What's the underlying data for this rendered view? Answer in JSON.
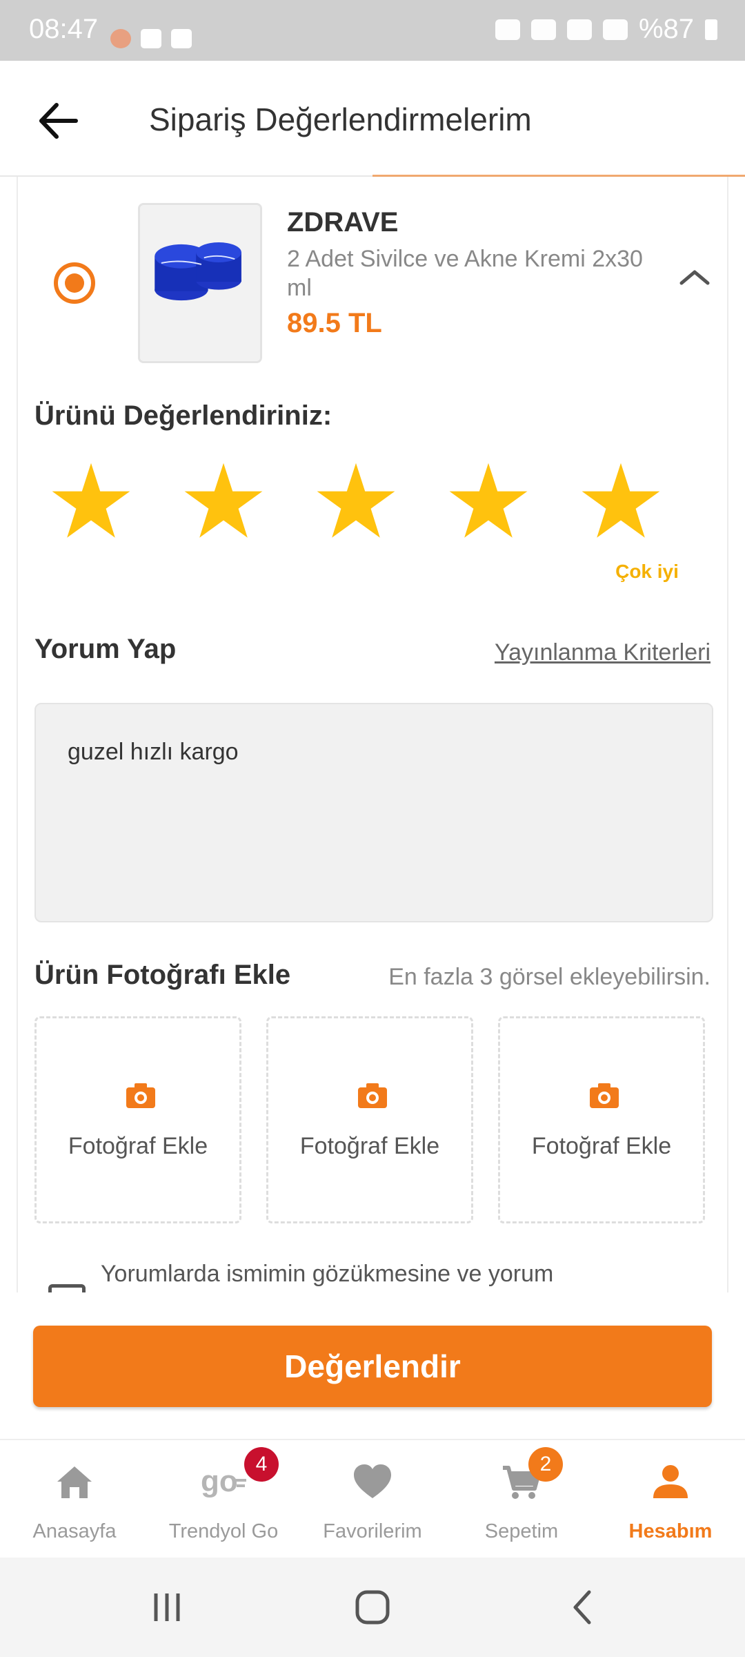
{
  "status_bar": {
    "time": "08:47",
    "battery": "%87"
  },
  "header": {
    "title": "Sipariş Değerlendirmelerim",
    "back_icon": "arrow-left-icon"
  },
  "product": {
    "brand": "ZDRAVE",
    "name": "2 Adet Sivilce ve Akne Kremi 2x30 ml",
    "price": "89.5 TL",
    "selected": true,
    "expanded_icon": "chevron-up-icon"
  },
  "rating": {
    "title": "Ürünü Değerlendiriniz:",
    "value": 5,
    "max": 5,
    "label": "Çok iyi",
    "star_color": "#FFC20E"
  },
  "comment": {
    "title": "Yorum Yap",
    "criteria_link": "Yayınlanma Kriterleri",
    "text": "guzel hızlı kargo"
  },
  "photos": {
    "title": "Ürün Fotoğrafı Ekle",
    "hint": "En fazla 3 görsel ekleyebilirsin.",
    "slots": [
      {
        "label": "Fotoğraf Ekle",
        "icon": "camera-icon"
      },
      {
        "label": "Fotoğraf Ekle",
        "icon": "camera-icon"
      },
      {
        "label": "Fotoğraf Ekle",
        "icon": "camera-icon"
      }
    ]
  },
  "consent": {
    "text": "Yorumlarda ismimin gözükmesine ve yorum"
  },
  "submit": {
    "label": "Değerlendir"
  },
  "bottom_nav": {
    "items": [
      {
        "label": "Anasayfa",
        "icon": "home-icon",
        "active": false
      },
      {
        "label": "Trendyol Go",
        "icon": "go-icon",
        "badge": "4",
        "active": false
      },
      {
        "label": "Favorilerim",
        "icon": "heart-icon",
        "active": false
      },
      {
        "label": "Sepetim",
        "icon": "cart-icon",
        "badge": "2",
        "active": false
      },
      {
        "label": "Hesabım",
        "icon": "user-icon",
        "active": true
      }
    ]
  },
  "colors": {
    "accent": "#F27A1A",
    "star": "#FFC20E",
    "badge_red": "#C8102E"
  }
}
